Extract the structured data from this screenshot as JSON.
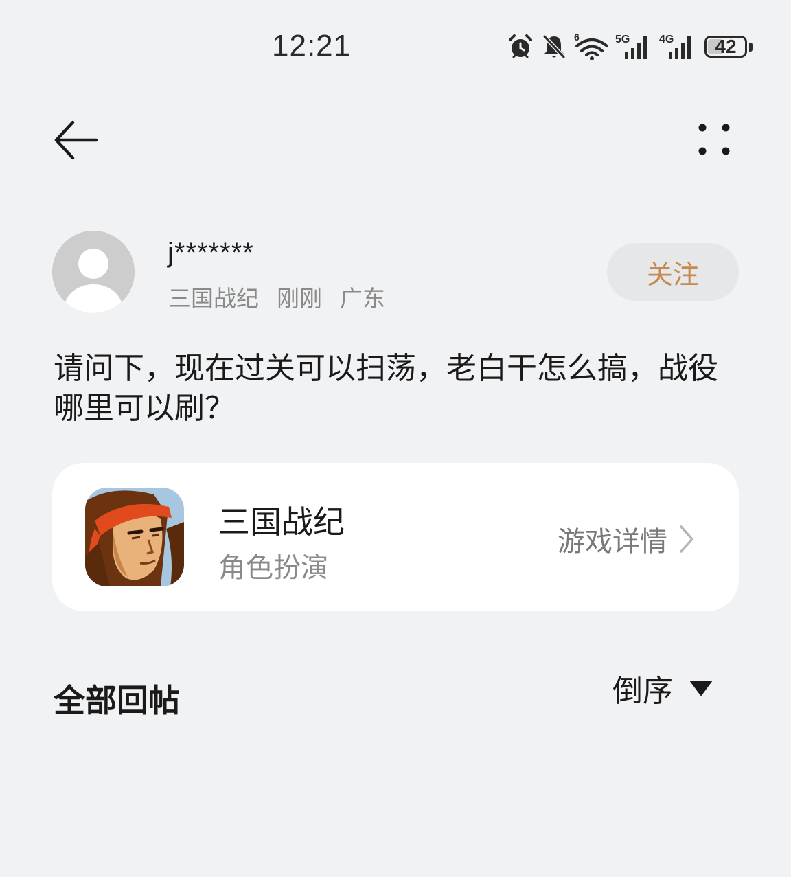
{
  "status_bar": {
    "time": "12:21",
    "wifi_label": "6",
    "sim1_label": "5G",
    "sim2_label": "4G",
    "battery_percent": 42,
    "battery_label": "42",
    "icons": [
      "alarm-icon",
      "bell-off-icon",
      "wifi-icon",
      "signal-5g-icon",
      "signal-4g-icon",
      "battery-icon"
    ]
  },
  "nav": {
    "back_icon": "arrow-left-icon",
    "more_icon": "four-dots-icon"
  },
  "author": {
    "name": "j*******",
    "game": "三国战纪",
    "time": "刚刚",
    "location": "广东",
    "follow_label": "关注"
  },
  "post": {
    "content": "请问下，现在过关可以扫荡，老白干怎么搞，战役哪里可以刷？"
  },
  "game_card": {
    "name": "三国战纪",
    "genre": "角色扮演",
    "detail_label": "游戏详情"
  },
  "replies": {
    "title": "全部回帖",
    "sort_label": "倒序"
  },
  "colors": {
    "background": "#f1f2f4",
    "follow_text": "#c8894e",
    "follow_bg": "#e6e7e9",
    "card_bg": "#ffffff",
    "meta_text": "#8a8a8a"
  }
}
